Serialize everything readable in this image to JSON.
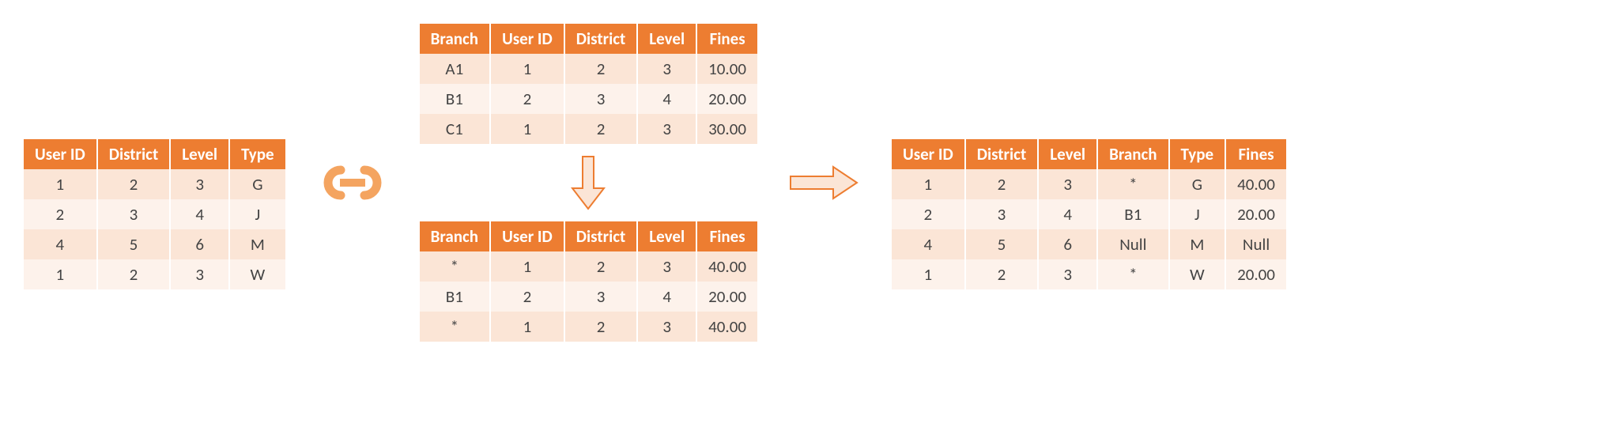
{
  "colors": {
    "accent": "#ED7D31",
    "rowOdd": "#FBE5D6",
    "rowEven": "#FDF2EB"
  },
  "leftTable": {
    "headers": [
      "User ID",
      "District",
      "Level",
      "Type"
    ],
    "rows": [
      [
        "1",
        "2",
        "3",
        "G"
      ],
      [
        "2",
        "3",
        "4",
        "J"
      ],
      [
        "4",
        "5",
        "6",
        "M"
      ],
      [
        "1",
        "2",
        "3",
        "W"
      ]
    ]
  },
  "topTable": {
    "headers": [
      "Branch",
      "User ID",
      "District",
      "Level",
      "Fines"
    ],
    "rows": [
      [
        "A1",
        "1",
        "2",
        "3",
        "10.00"
      ],
      [
        "B1",
        "2",
        "3",
        "4",
        "20.00"
      ],
      [
        "C1",
        "1",
        "2",
        "3",
        "30.00"
      ]
    ]
  },
  "bottomTable": {
    "headers": [
      "Branch",
      "User ID",
      "District",
      "Level",
      "Fines"
    ],
    "rows": [
      [
        "*",
        "1",
        "2",
        "3",
        "40.00"
      ],
      [
        "B1",
        "2",
        "3",
        "4",
        "20.00"
      ],
      [
        "*",
        "1",
        "2",
        "3",
        "40.00"
      ]
    ]
  },
  "rightTable": {
    "headers": [
      "User ID",
      "District",
      "Level",
      "Branch",
      "Type",
      "Fines"
    ],
    "rows": [
      [
        "1",
        "2",
        "3",
        "*",
        "G",
        "40.00"
      ],
      [
        "2",
        "3",
        "4",
        "B1",
        "J",
        "20.00"
      ],
      [
        "4",
        "5",
        "6",
        "Null",
        "M",
        "Null"
      ],
      [
        "1",
        "2",
        "3",
        "*",
        "W",
        "20.00"
      ]
    ]
  },
  "icons": {
    "link": "link-icon",
    "downArrow": "down-arrow",
    "rightArrow": "right-arrow"
  }
}
